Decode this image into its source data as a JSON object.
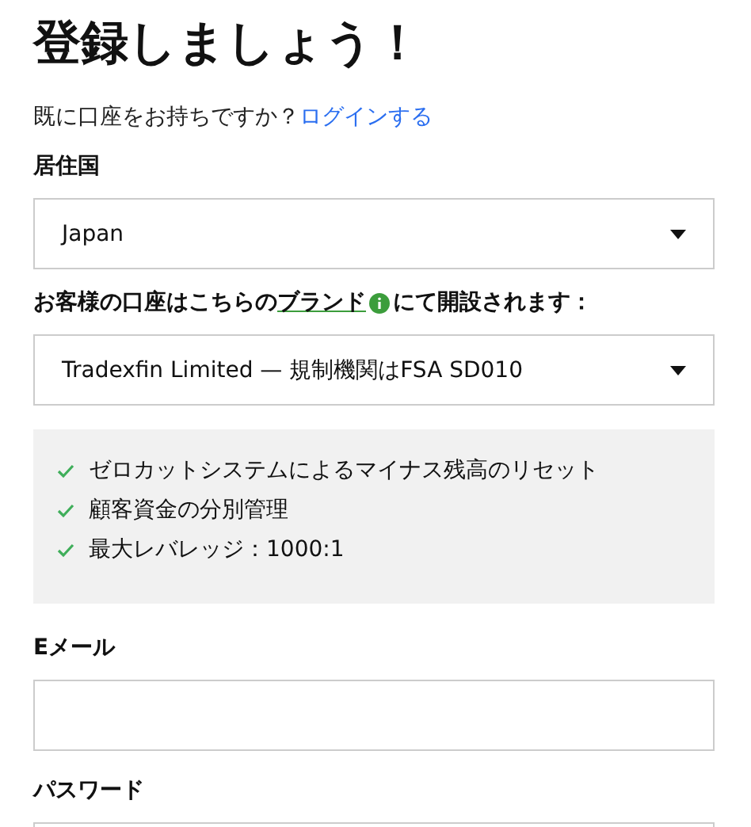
{
  "title": "登録しましょう！",
  "login_prompt": {
    "text": "既に口座をお持ちですか？",
    "link": "ログインする"
  },
  "country": {
    "label": "居住国",
    "value": "Japan"
  },
  "brand": {
    "label_before": "お客様の口座はこちらの",
    "label_link": "ブランド",
    "label_after": "にて開設されます：",
    "value": "Tradexfin Limited — 規制機関はFSA SD010"
  },
  "features": [
    {
      "text": "ゼロカットシステムによるマイナス残高のリセット",
      "checked": true
    },
    {
      "text": "顧客資金の分別管理",
      "checked": true
    },
    {
      "text": "最大レバレッジ：1000:1",
      "checked": true
    }
  ],
  "email": {
    "label": "Eメール"
  },
  "password": {
    "label": "パスワード"
  }
}
